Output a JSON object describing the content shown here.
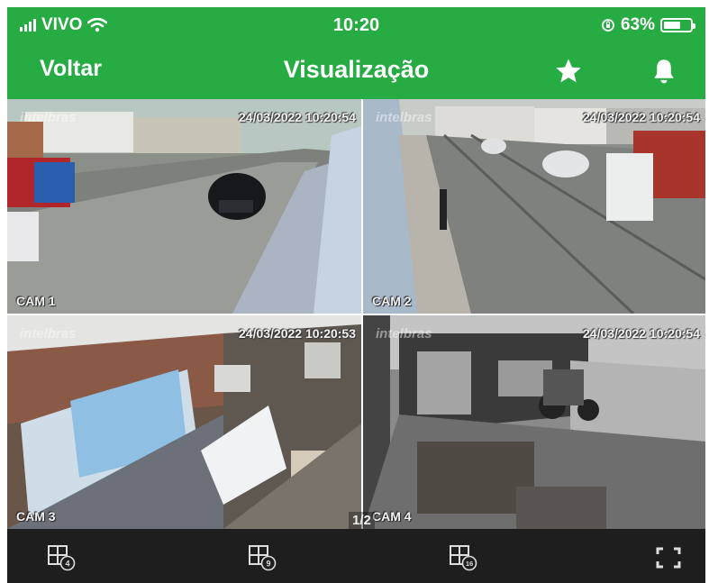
{
  "status_bar": {
    "carrier": "VIVO",
    "time": "10:20",
    "battery": "63%",
    "battery_level": 0.63
  },
  "nav": {
    "back_label": "Voltar",
    "title": "Visualização",
    "favorite_icon": "star-icon",
    "notifications_icon": "bell-icon"
  },
  "cameras": [
    {
      "label": "CAM 1",
      "timestamp": "24/03/2022 10:20:54",
      "watermark": "intelbras"
    },
    {
      "label": "CAM 2",
      "timestamp": "24/03/2022 10:20:54",
      "watermark": "intelbras"
    },
    {
      "label": "CAM 3",
      "timestamp": "24/03/2022 10:20:53",
      "watermark": "intelbras"
    },
    {
      "label": "CAM 4",
      "timestamp": "24/03/2022 10:20:54",
      "watermark": "intelbras"
    }
  ],
  "page_indicator": "1/2",
  "toolbar": {
    "layout_4": "4",
    "layout_9": "9",
    "layout_16": "16",
    "fullscreen_icon": "fullscreen-icon"
  },
  "colors": {
    "header_bg": "#27ac43",
    "toolbar_bg": "#1e1e1e"
  }
}
